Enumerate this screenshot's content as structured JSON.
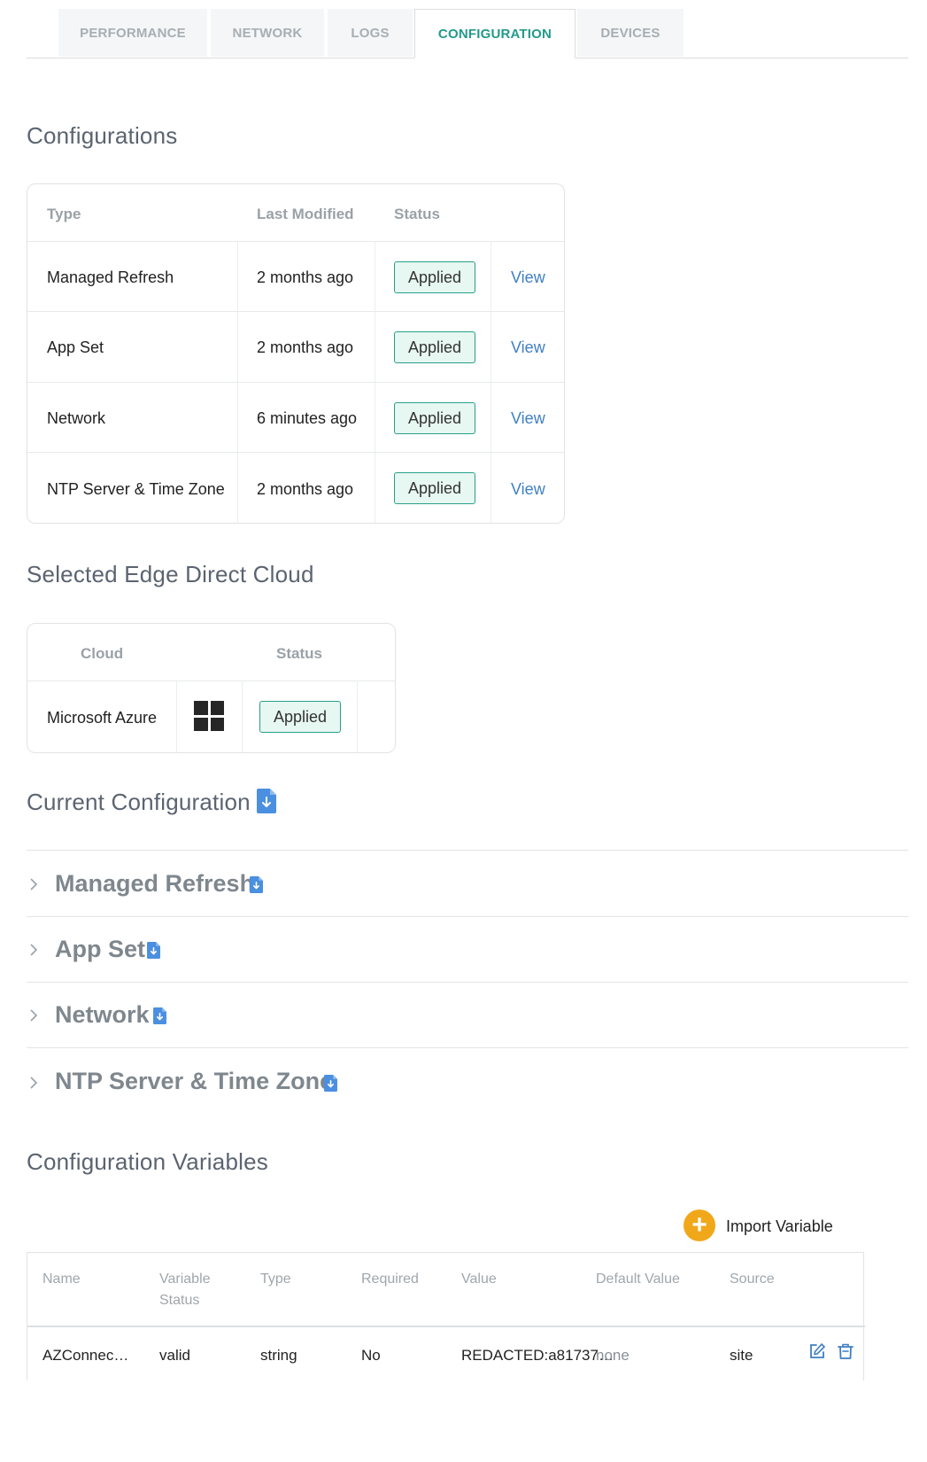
{
  "tabs": [
    {
      "label": "PERFORMANCE"
    },
    {
      "label": "NETWORK"
    },
    {
      "label": "LOGS"
    },
    {
      "label": "CONFIGURATION"
    },
    {
      "label": "DEVICES"
    }
  ],
  "configurations": {
    "title": "Configurations",
    "headers": {
      "type": "Type",
      "last_modified": "Last Modified",
      "status": "Status"
    },
    "rows": [
      {
        "type": "Managed Refresh",
        "last_modified": "2 months ago",
        "status": "Applied",
        "action": "View"
      },
      {
        "type": "App Set",
        "last_modified": "2 months ago",
        "status": "Applied",
        "action": "View"
      },
      {
        "type": "Network",
        "last_modified": "6 minutes ago",
        "status": "Applied",
        "action": "View"
      },
      {
        "type": "NTP Server & Time Zone",
        "last_modified": "2 months ago",
        "status": "Applied",
        "action": "View"
      }
    ]
  },
  "edge_cloud": {
    "title": "Selected Edge Direct Cloud",
    "headers": {
      "cloud": "Cloud",
      "status": "Status"
    },
    "row": {
      "cloud": "Microsoft Azure",
      "logo_icon": "windows-logo-icon",
      "status": "Applied"
    }
  },
  "current_configuration": {
    "title": "Current Configuration",
    "items": [
      {
        "label": "Managed Refresh"
      },
      {
        "label": "App Set"
      },
      {
        "label": "Network"
      },
      {
        "label": "NTP Server & Time Zone"
      }
    ]
  },
  "config_variables": {
    "title": "Configuration Variables",
    "import_label": "Import Variable",
    "headers": {
      "name": "Name",
      "variable_status_1": "Variable",
      "variable_status_2": "Status",
      "type": "Type",
      "required": "Required",
      "value": "Value",
      "default_value": "Default Value",
      "source": "Source"
    },
    "rows": [
      {
        "name": "AZConnec…",
        "variable_status": "valid",
        "type": "string",
        "required": "No",
        "value": "REDACTED:a81737…",
        "default_value": "none",
        "source": "site"
      }
    ]
  },
  "colors": {
    "accent": "#239a8a",
    "link": "#3f7fc4",
    "badge_border": "#28a08a",
    "import": "#f0a81a",
    "doc_icon": "#4a8fe0"
  }
}
